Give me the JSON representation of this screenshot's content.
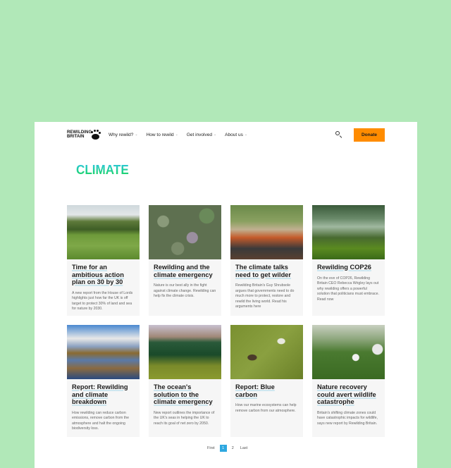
{
  "brand": {
    "line1": "REWILDING",
    "line2": "BRITAIN",
    "icon": "paw-print-icon"
  },
  "nav": {
    "items": [
      {
        "label": "Why rewild?"
      },
      {
        "label": "How to rewild"
      },
      {
        "label": "Get involved"
      },
      {
        "label": "About us"
      }
    ],
    "chevron": "⌄",
    "search_icon": "search-icon",
    "donate_label": "Donate",
    "donate_color": "#ff8c00"
  },
  "page": {
    "title": "CLIMATE"
  },
  "articles": [
    {
      "title": "Time for an ambitious action plan on 30 by 30",
      "description": "A new report from the House of Lords highlights just how far the UK is off target to protect 30% of land and sea for nature by 2030.",
      "image": "hikers-in-meadow"
    },
    {
      "title": "Rewilding and the climate emergency",
      "description": "Nature is our best ally in the fight against climate change. Rewilding can help fix the climate crisis.",
      "image": "aerial-forest-canopy"
    },
    {
      "title": "The climate talks need to get wilder",
      "description": "Rewilding Britain's Guy Shrubsole argues that governments need to do much more to protect, restore and rewild the living world. Read his arguments here",
      "image": "climate-march-crowd"
    },
    {
      "title": "Rewilding COP26",
      "description": "On the eve of COP26, Rewilding Britain CEO Rebecca Wrigley lays out why rewilding offers a powerful solution that politicians must embrace. Read now",
      "image": "woodland-trees"
    },
    {
      "title": "Report: Rewilding and climate breakdown",
      "description": "How rewilding can reduce carbon emissions, remove carbon from the atmosphere and halt the ongoing biodiversity loss.",
      "image": "wetland-reflection"
    },
    {
      "title": "The ocean's solution to the climate emergency",
      "description": "New report outlines the importance of the UK's seas in helping the UK to reach its goal of net zero by 2050.",
      "image": "underwater-seagrass"
    },
    {
      "title": "Report: Blue carbon",
      "description": "How our marine ecosystems can help remove carbon from our atmosphere.",
      "image": "saltmarsh-aerial"
    },
    {
      "title": "Nature recovery could avert wildlife catastrophe",
      "description": "Britain's shifting climate zones could have catastrophic impacts for wildlife, says new report by Rewilding Britain.",
      "image": "wildflowers"
    }
  ],
  "pagination": {
    "first": "First",
    "pages": [
      "1",
      "2"
    ],
    "current": "1",
    "last": "Last"
  }
}
